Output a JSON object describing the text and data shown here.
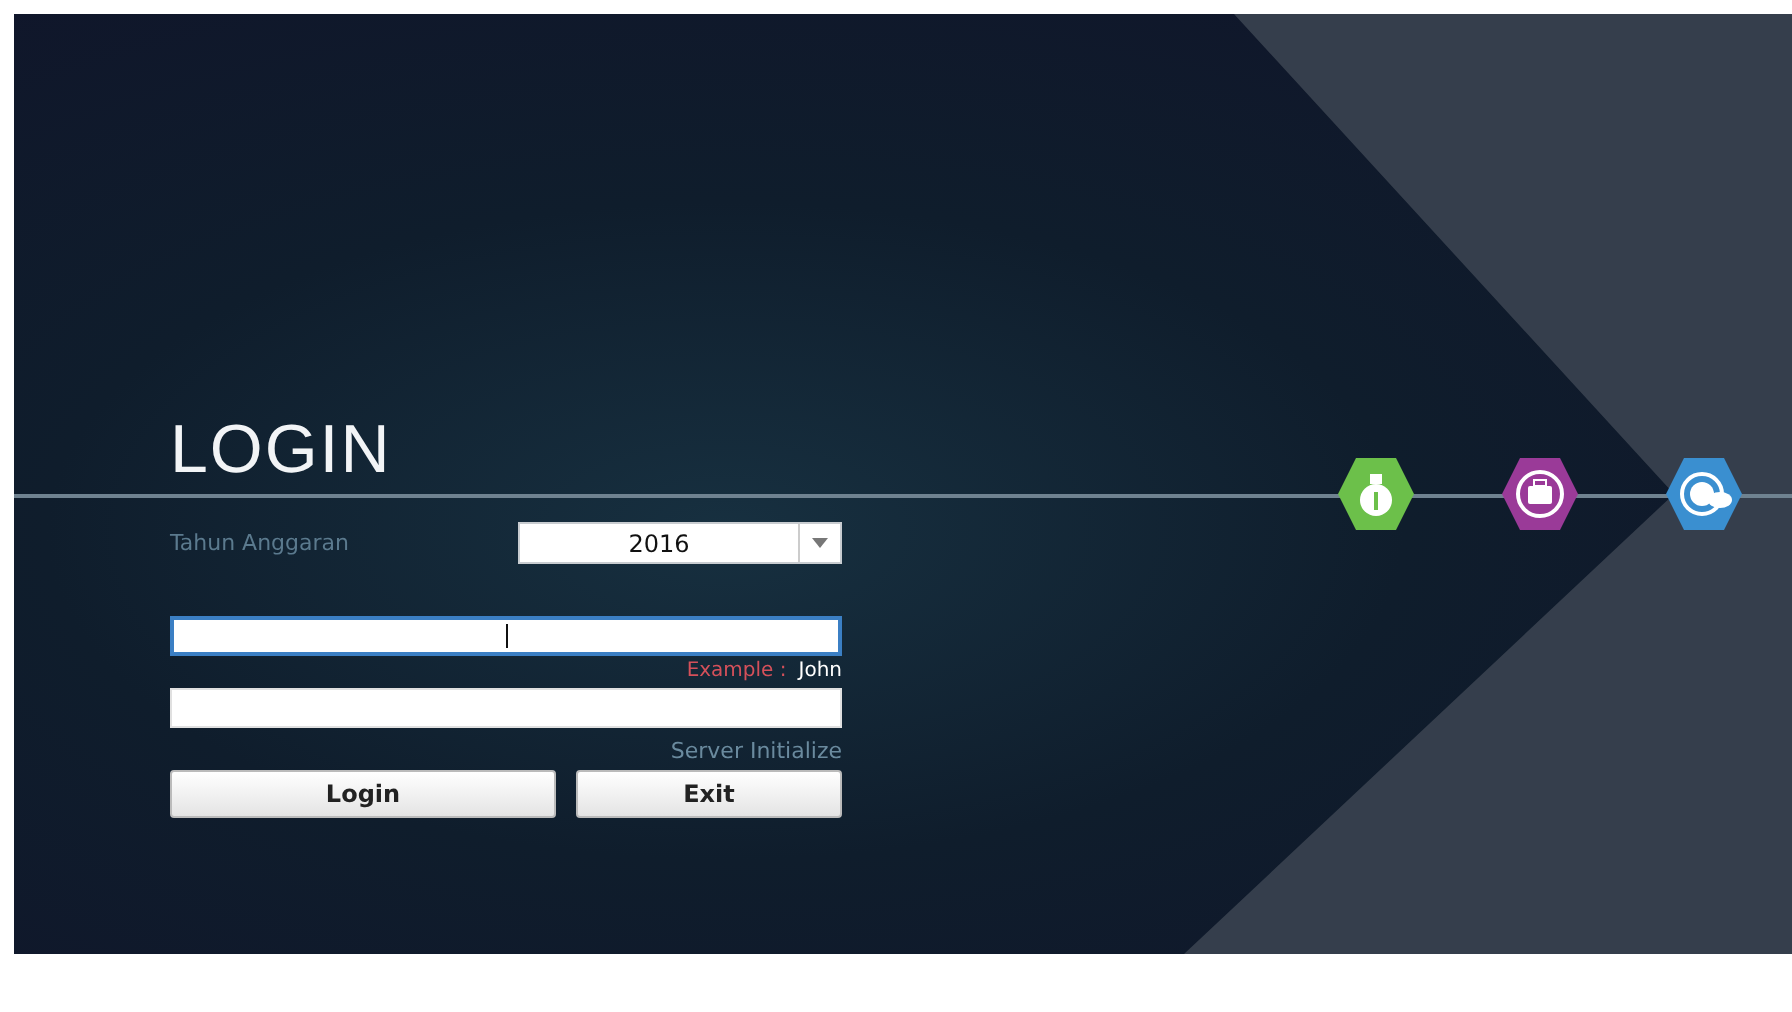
{
  "title": "LOGIN",
  "year_field": {
    "label": "Tahun Anggaran",
    "value": "2016"
  },
  "username_field": {
    "focused": true,
    "hint": "Example :",
    "hint_value": "John"
  },
  "password_field": {
    "focused": false
  },
  "status": "Server Initialize",
  "buttons": [
    "Login",
    "Exit"
  ]
}
